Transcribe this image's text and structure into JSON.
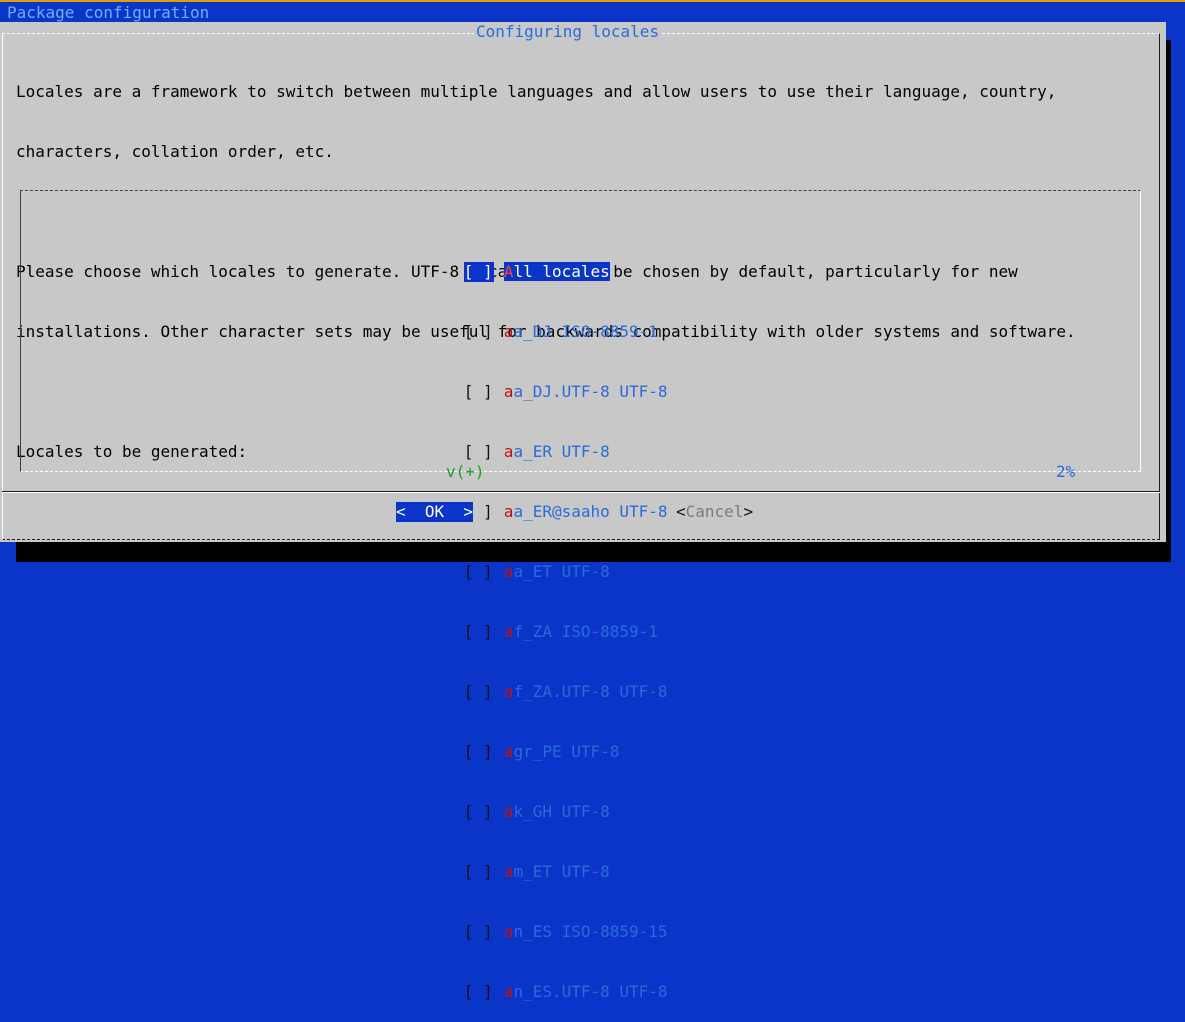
{
  "backtitle": "Package configuration",
  "dialog": {
    "title": "Configuring locales",
    "intro_lines": [
      "Locales are a framework to switch between multiple languages and allow users to use their language, country,",
      "characters, collation order, etc.",
      "",
      "Please choose which locales to generate. UTF-8 locales should be chosen by default, particularly for new",
      "installations. Other character sets may be useful for backwards compatibility with older systems and software.",
      "",
      "Locales to be generated:"
    ],
    "items": [
      {
        "checkbox": "[ ]",
        "hotkey": "A",
        "rest": "ll locales",
        "checked": false,
        "selected": true
      },
      {
        "checkbox": "[ ]",
        "hotkey": "a",
        "rest": "a_DJ ISO-8859-1",
        "checked": false,
        "selected": false
      },
      {
        "checkbox": "[ ]",
        "hotkey": "a",
        "rest": "a_DJ.UTF-8 UTF-8",
        "checked": false,
        "selected": false
      },
      {
        "checkbox": "[ ]",
        "hotkey": "a",
        "rest": "a_ER UTF-8",
        "checked": false,
        "selected": false
      },
      {
        "checkbox": "[ ]",
        "hotkey": "a",
        "rest": "a_ER@saaho UTF-8",
        "checked": false,
        "selected": false
      },
      {
        "checkbox": "[ ]",
        "hotkey": "a",
        "rest": "a_ET UTF-8",
        "checked": false,
        "selected": false
      },
      {
        "checkbox": "[ ]",
        "hotkey": "a",
        "rest": "f_ZA ISO-8859-1",
        "checked": false,
        "selected": false
      },
      {
        "checkbox": "[ ]",
        "hotkey": "a",
        "rest": "f_ZA.UTF-8 UTF-8",
        "checked": false,
        "selected": false
      },
      {
        "checkbox": "[ ]",
        "hotkey": "a",
        "rest": "gr_PE UTF-8",
        "checked": false,
        "selected": false
      },
      {
        "checkbox": "[ ]",
        "hotkey": "a",
        "rest": "k_GH UTF-8",
        "checked": false,
        "selected": false
      },
      {
        "checkbox": "[ ]",
        "hotkey": "a",
        "rest": "m_ET UTF-8",
        "checked": false,
        "selected": false
      },
      {
        "checkbox": "[ ]",
        "hotkey": "a",
        "rest": "n_ES ISO-8859-15",
        "checked": false,
        "selected": false
      },
      {
        "checkbox": "[ ]",
        "hotkey": "a",
        "rest": "n_ES.UTF-8 UTF-8",
        "checked": false,
        "selected": false
      }
    ],
    "scroll_more": "v(+)",
    "scroll_percent": "2%",
    "buttons": {
      "ok": "<  OK  >",
      "cancel_open": "<",
      "cancel_label": "Cancel",
      "cancel_close": ">"
    }
  },
  "colors": {
    "background": "#0a35c8",
    "dialog": "#c8c8c8",
    "title": "#2a6adc",
    "hotkey": "#c01010",
    "scroll_indicator": "#20a020"
  }
}
